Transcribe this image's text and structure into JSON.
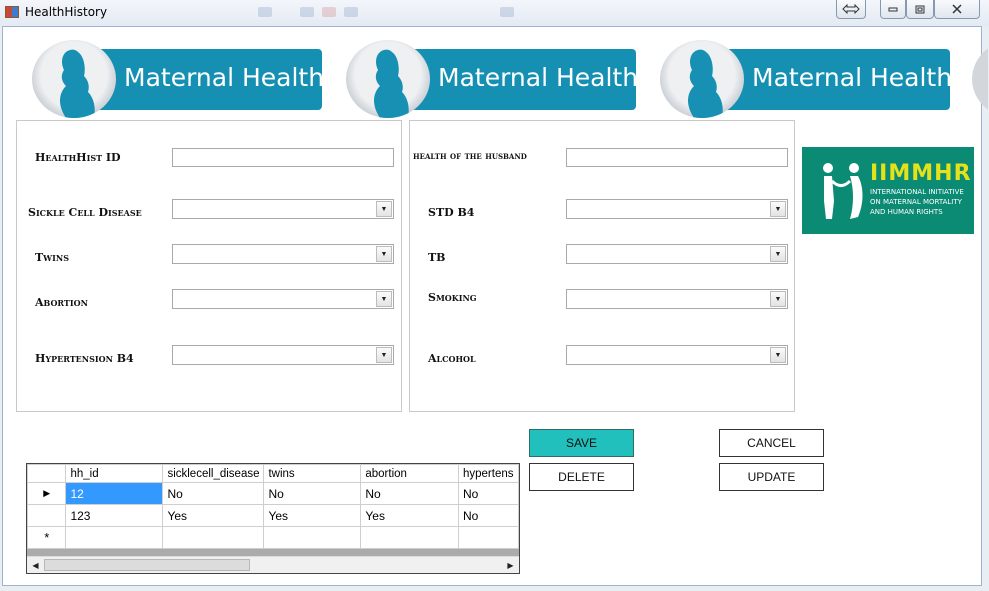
{
  "window": {
    "title": "HealthHistory"
  },
  "banner": {
    "text": "Maternal Health"
  },
  "form": {
    "left": {
      "healthhist_id_label": "HealthHist ID",
      "sickle_cell_label": "Sickle Cell Disease",
      "twins_label": "Twins",
      "abortion_label": "Abortion",
      "hypertension_label": "Hypertension B4"
    },
    "right": {
      "husband_health_label": "health of the husband",
      "std_label": "STD B4",
      "tb_label": "TB",
      "smoking_label": "Smoking",
      "alcohol_label": "Alcohol"
    }
  },
  "logo": {
    "abbr": "IIMMHR",
    "line1": "INTERNATIONAL INITIATIVE",
    "line2": "ON MATERNAL MORTALITY",
    "line3": "AND HUMAN RIGHTS",
    "background": "#0b8a74",
    "accent": "#e6e21a"
  },
  "buttons": {
    "save": "SAVE",
    "cancel": "CANCEL",
    "delete": "DELETE",
    "update": "UPDATE"
  },
  "grid": {
    "columns": [
      "hh_id",
      "sicklecell_disease",
      "twins",
      "abortion",
      "hypertens"
    ],
    "rows": [
      [
        "12",
        "No",
        "No",
        "No",
        "No"
      ],
      [
        "123",
        "Yes",
        "Yes",
        "Yes",
        "No"
      ]
    ],
    "new_row_marker": "*",
    "current_row_marker": "▶"
  },
  "colors": {
    "banner_blue": "#1590b3",
    "save_button": "#21c0bd",
    "selection": "#3399ff"
  }
}
